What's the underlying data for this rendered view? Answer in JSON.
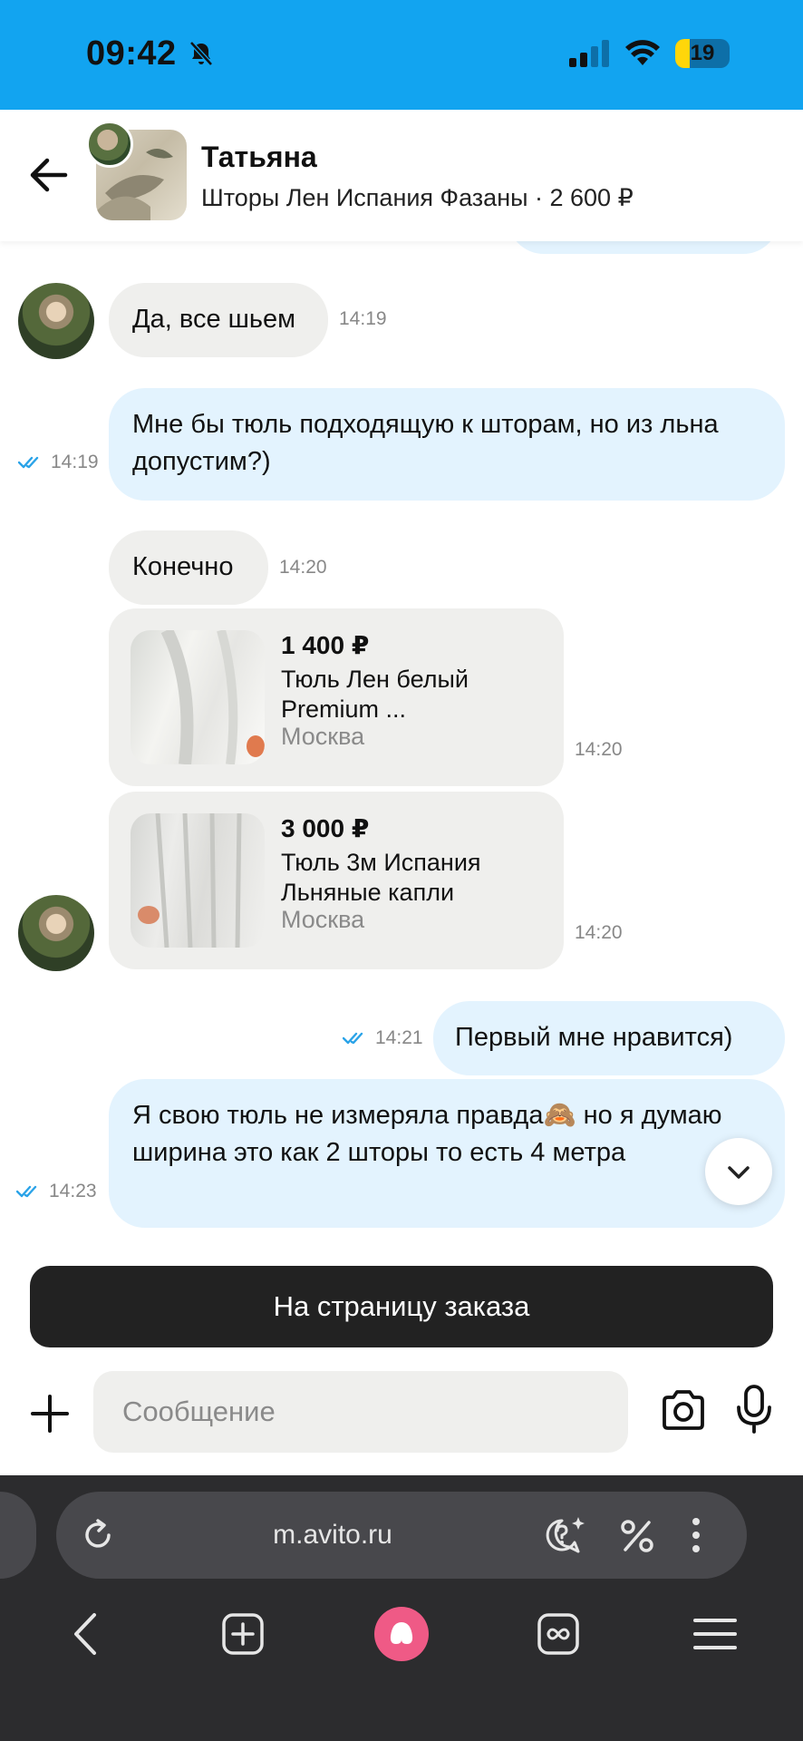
{
  "status_bar": {
    "time": "09:42",
    "battery": "19"
  },
  "header": {
    "name": "Татьяна",
    "subtitle": "Шторы Лен Испания Фазаны · 2 600 ₽"
  },
  "messages": [
    {
      "text": "Да, все шьем",
      "time": "14:19"
    },
    {
      "text": "Мне бы тюль подходящую к шторам, но из льна допустим?)",
      "time": "14:19"
    },
    {
      "text": "Конечно",
      "time": "14:20"
    },
    {
      "price": "1 400 ₽",
      "title": "Тюль Лен белый Premium ...",
      "city": "Москва",
      "time": "14:20"
    },
    {
      "price": "3 000 ₽",
      "title": "Тюль 3м Испания Льняные капли",
      "city": "Москва",
      "time": "14:20"
    },
    {
      "text": "Первый мне нравится)",
      "time": "14:21"
    },
    {
      "text": "Я свою тюль не измеряла правда🙈 но я думаю ширина это как 2 шторы то есть 4 метра",
      "time": "14:23"
    }
  ],
  "order_button": "На страницу заказа",
  "composer": {
    "placeholder": "Сообщение"
  },
  "browser": {
    "url": "m.avito.ru"
  },
  "colors": {
    "status_bar": "#12a4f0",
    "incoming_bubble": "#efefed",
    "outgoing_bubble": "#e3f3fe",
    "check_marks": "#2aa3e8",
    "alice": "#ef5a86"
  }
}
